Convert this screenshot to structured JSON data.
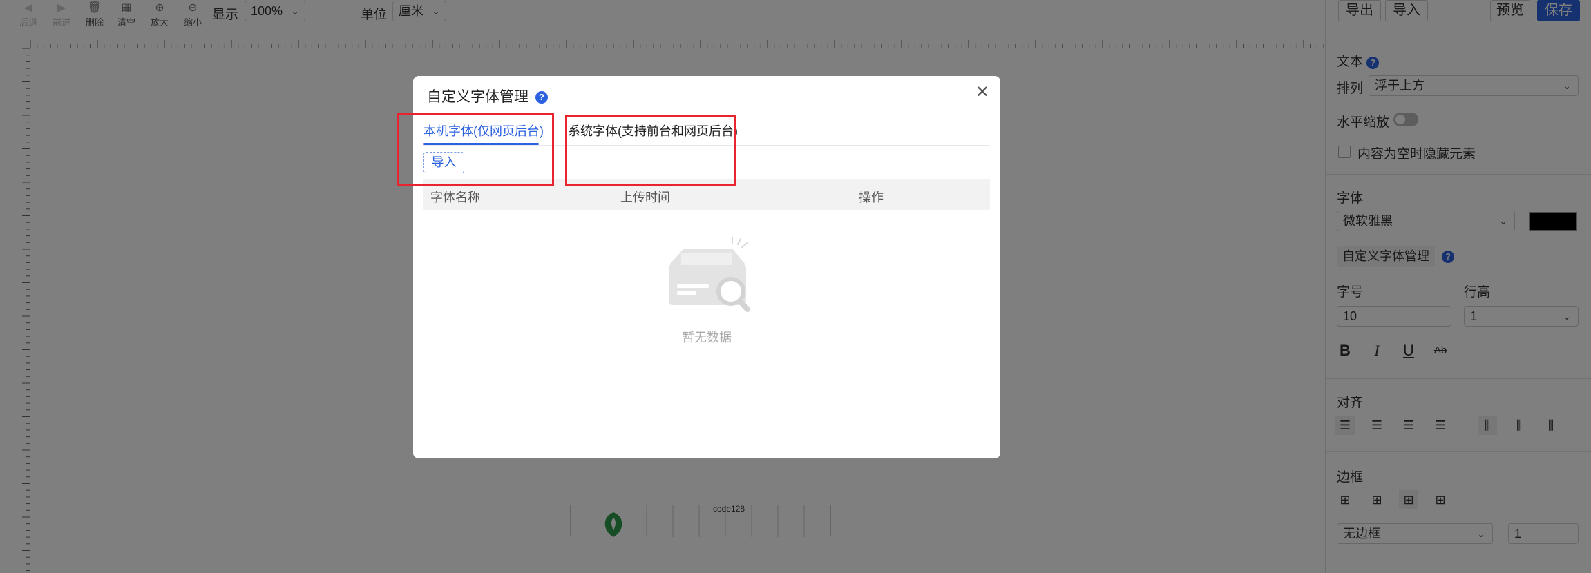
{
  "toolbar": {
    "tools": [
      {
        "label": "后退",
        "icon": "undo-icon"
      },
      {
        "label": "前进",
        "icon": "redo-icon"
      },
      {
        "label": "删除",
        "icon": "trash-icon"
      },
      {
        "label": "清空",
        "icon": "clear-icon"
      },
      {
        "label": "放大",
        "icon": "zoom-in-icon"
      },
      {
        "label": "缩小",
        "icon": "zoom-out-icon"
      }
    ],
    "display_label": "显示",
    "display_value": "100%",
    "unit_label": "单位",
    "unit_value": "厘米"
  },
  "canvas": {
    "barcode_text": "code128"
  },
  "sidebar": {
    "export_label": "导出",
    "import_label": "导入",
    "preview_label": "预览",
    "save_label": "保存",
    "text_section": "文本",
    "arrange_label": "排列",
    "arrange_value": "浮于上方",
    "hscale_label": "水平缩放",
    "hide_empty_label": "内容为空时隐藏元素",
    "font_label": "字体",
    "font_value": "微软雅黑",
    "font_color": "#000000",
    "custom_font_button": "自定义字体管理",
    "size_label": "字号",
    "size_value": "10",
    "line_height_label": "行高",
    "line_height_value": "1",
    "align_label": "对齐",
    "border_label": "边框",
    "border_value": "无边框",
    "border_width": "1"
  },
  "modal": {
    "title": "自定义字体管理",
    "tabs": [
      {
        "label": "本机字体(仅网页后台)",
        "active": true
      },
      {
        "label": "系统字体(支持前台和网页后台)",
        "active": false
      }
    ],
    "import_button": "导入",
    "columns": [
      "字体名称",
      "上传时间",
      "操作"
    ],
    "empty_text": "暂无数据"
  },
  "colors": {
    "primary": "#2c62e0",
    "highlight": "#e8252f"
  }
}
